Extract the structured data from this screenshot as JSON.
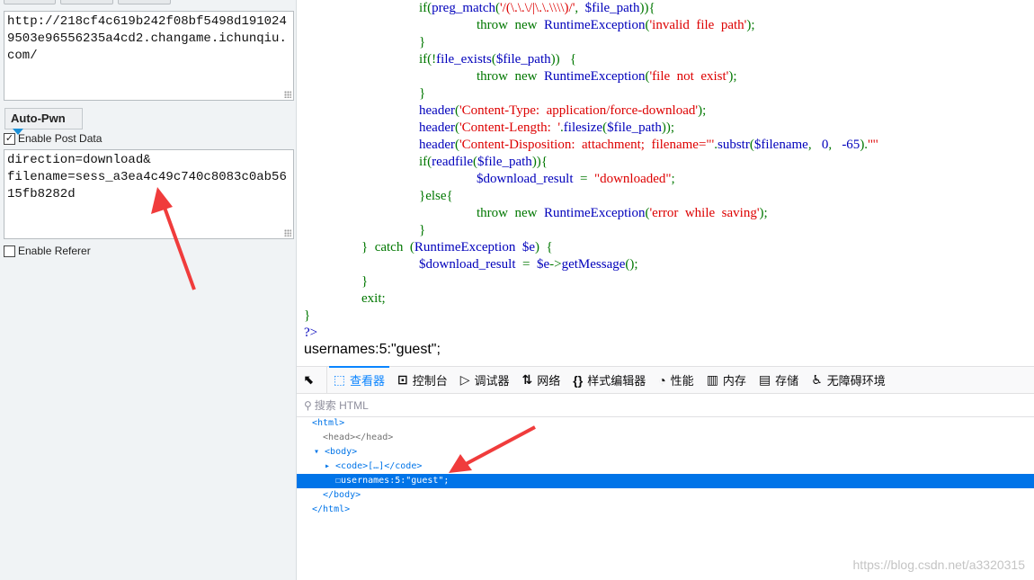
{
  "left": {
    "url_text": "http://218cf4c619b242f08bf5498d1910249503e96556235a4cd2.changame.ichunqiu.com/",
    "autopwn_label": "Auto-Pwn",
    "post_data_label": "Enable Post Data",
    "post_data_checked": true,
    "post_text": "direction=download&\nfilename=sess_a3ea4c49c740c8083c0ab5615fb8282d",
    "referer_label": "Enable Referer",
    "referer_checked": false
  },
  "code_lines": [
    {
      "indent": 2,
      "t": [
        [
          "k",
          "if("
        ],
        [
          "f",
          "preg_match"
        ],
        [
          "k",
          "("
        ],
        [
          "s",
          "'/(\\.\\.\\/|\\.\\.\\\\\\\\)/'"
        ],
        [
          "k",
          ",  "
        ],
        [
          "f",
          "$file_path"
        ],
        [
          "k",
          "))"
        ],
        [
          "k",
          "{"
        ]
      ]
    },
    {
      "indent": 3,
      "t": [
        [
          "k",
          "throw  new  "
        ],
        [
          "f",
          "RuntimeException"
        ],
        [
          "k",
          "("
        ],
        [
          "s",
          "'invalid  file  path'"
        ],
        [
          "k",
          ");"
        ]
      ]
    },
    {
      "indent": 2,
      "t": [
        [
          "k",
          "}"
        ]
      ]
    },
    {
      "indent": 2,
      "t": [
        [
          "k",
          "if(!"
        ],
        [
          "f",
          "file_exists"
        ],
        [
          "k",
          "("
        ],
        [
          "f",
          "$file_path"
        ],
        [
          "k",
          "))   {"
        ]
      ]
    },
    {
      "indent": 3,
      "t": [
        [
          "k",
          "throw  new  "
        ],
        [
          "f",
          "RuntimeException"
        ],
        [
          "k",
          "("
        ],
        [
          "s",
          "'file  not  exist'"
        ],
        [
          "k",
          ");"
        ]
      ]
    },
    {
      "indent": 2,
      "t": [
        [
          "k",
          "}"
        ]
      ]
    },
    {
      "indent": 2,
      "t": [
        [
          "f",
          "header"
        ],
        [
          "k",
          "("
        ],
        [
          "s",
          "'Content-Type:  application/force-download'"
        ],
        [
          "k",
          ");"
        ]
      ]
    },
    {
      "indent": 2,
      "t": [
        [
          "f",
          "header"
        ],
        [
          "k",
          "("
        ],
        [
          "s",
          "'Content-Length:  '"
        ],
        [
          "k",
          "."
        ],
        [
          "f",
          "filesize"
        ],
        [
          "k",
          "("
        ],
        [
          "f",
          "$file_path"
        ],
        [
          "k",
          "));"
        ]
      ]
    },
    {
      "indent": 2,
      "t": [
        [
          "f",
          "header"
        ],
        [
          "k",
          "("
        ],
        [
          "s",
          "'Content-Disposition:  attachment;  filename=\"'"
        ],
        [
          "k",
          "."
        ],
        [
          "f",
          "substr"
        ],
        [
          "k",
          "("
        ],
        [
          "f",
          "$filename"
        ],
        [
          "k",
          ",   "
        ],
        [
          "f",
          "0"
        ],
        [
          "k",
          ",   "
        ],
        [
          "f",
          "-65"
        ],
        [
          "k",
          ")."
        ],
        [
          "s",
          "'\"'"
        ]
      ]
    },
    {
      "indent": 2,
      "t": [
        [
          "k",
          "if("
        ],
        [
          "f",
          "readfile"
        ],
        [
          "k",
          "("
        ],
        [
          "f",
          "$file_path"
        ],
        [
          "k",
          "))"
        ],
        [
          "k",
          "{"
        ]
      ]
    },
    {
      "indent": 3,
      "t": [
        [
          "f",
          "$download_result"
        ],
        [
          "k",
          "  =  "
        ],
        [
          "s",
          "\"downloaded\""
        ],
        [
          "k",
          ";"
        ]
      ]
    },
    {
      "indent": 2,
      "t": [
        [
          "k",
          "}else{"
        ]
      ]
    },
    {
      "indent": 3,
      "t": [
        [
          "k",
          "throw  new  "
        ],
        [
          "f",
          "RuntimeException"
        ],
        [
          "k",
          "("
        ],
        [
          "s",
          "'error  while  saving'"
        ],
        [
          "k",
          ");"
        ]
      ]
    },
    {
      "indent": 2,
      "t": [
        [
          "k",
          "}"
        ]
      ]
    },
    {
      "indent": 1,
      "t": [
        [
          "k",
          "}  catch  ("
        ],
        [
          "f",
          "RuntimeException  $e"
        ],
        [
          "k",
          ")  {"
        ]
      ]
    },
    {
      "indent": 2,
      "t": [
        [
          "f",
          "$download_result"
        ],
        [
          "k",
          "  =  "
        ],
        [
          "f",
          "$e"
        ],
        [
          "k",
          "->"
        ],
        [
          "f",
          "getMessage"
        ],
        [
          "k",
          "();"
        ]
      ]
    },
    {
      "indent": 1,
      "t": [
        [
          "k",
          "}"
        ]
      ]
    },
    {
      "indent": 1,
      "t": [
        [
          "k",
          "exit;"
        ]
      ]
    },
    {
      "indent": 0,
      "t": [
        [
          "k",
          "}"
        ]
      ]
    },
    {
      "indent": 0,
      "t": [
        [
          "f",
          "?>"
        ]
      ]
    }
  ],
  "output_text": "usernames:5:\"guest\";",
  "devtools": {
    "tabs": [
      {
        "icon": "⬚",
        "label": "查看器",
        "active": true,
        "name": "inspector"
      },
      {
        "icon": "⊡",
        "label": "控制台",
        "name": "console"
      },
      {
        "icon": "▷",
        "label": "调试器",
        "name": "debugger"
      },
      {
        "icon": "⇅",
        "label": "网络",
        "name": "network"
      },
      {
        "icon": "{}",
        "label": "样式编辑器",
        "name": "style-editor"
      },
      {
        "icon": "◔",
        "label": "性能",
        "name": "performance"
      },
      {
        "icon": "▥",
        "label": "内存",
        "name": "memory"
      },
      {
        "icon": "▤",
        "label": "存储",
        "name": "storage"
      },
      {
        "icon": "♿",
        "label": "无障碍环境",
        "name": "accessibility"
      }
    ],
    "picker_icon": "element-picker-icon",
    "search_placeholder": "搜索 HTML",
    "tree": [
      {
        "indent": 0,
        "text": "<html>"
      },
      {
        "indent": 1,
        "text": "<head></head>",
        "gray": true
      },
      {
        "indent": 1,
        "text": "▾ <body>",
        "shift": -1
      },
      {
        "indent": 2,
        "text": "▸ <code>[…]</code>",
        "shift": -1
      },
      {
        "indent": 3,
        "text": "☐usernames:5:\"guest\";",
        "selected": true,
        "shift": -1
      },
      {
        "indent": 1,
        "text": "</body>"
      },
      {
        "indent": 0,
        "text": "</html>"
      }
    ],
    "selected_color": "#0074e8"
  },
  "watermark": "https://blog.csdn.net/a3320315",
  "annotation_color": "#f03c3c"
}
